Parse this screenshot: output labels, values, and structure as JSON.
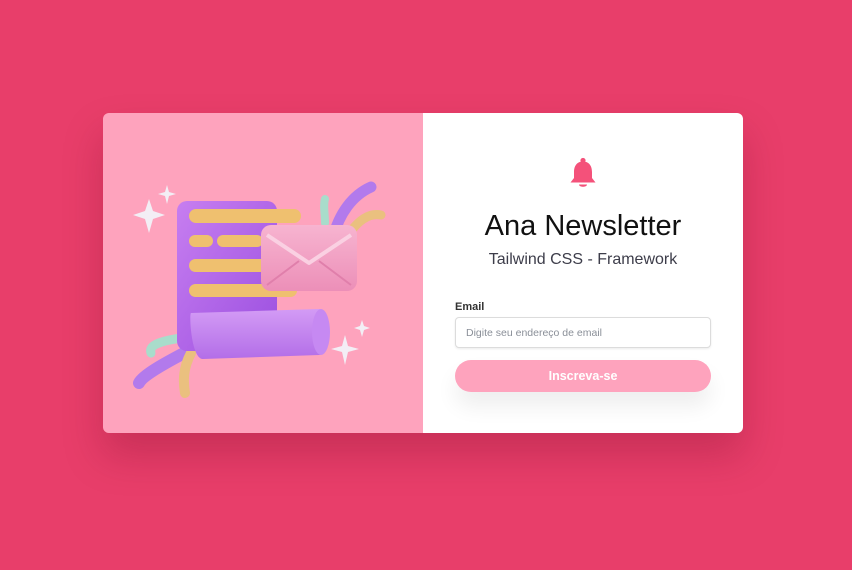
{
  "newsletter": {
    "title": "Ana Newsletter",
    "subtitle": "Tailwind CSS - Framework"
  },
  "form": {
    "email_label": "Email",
    "email_placeholder": "Digite seu endereço de email",
    "email_value": "",
    "submit_label": "Inscreva-se"
  },
  "icons": {
    "header": "bell-icon",
    "illustration": "newsletter-illustration"
  },
  "colors": {
    "page_background": "#e83e6a",
    "left_panel": "#fea3bd",
    "accent": "#f4517a",
    "button": "#fea3bd"
  }
}
